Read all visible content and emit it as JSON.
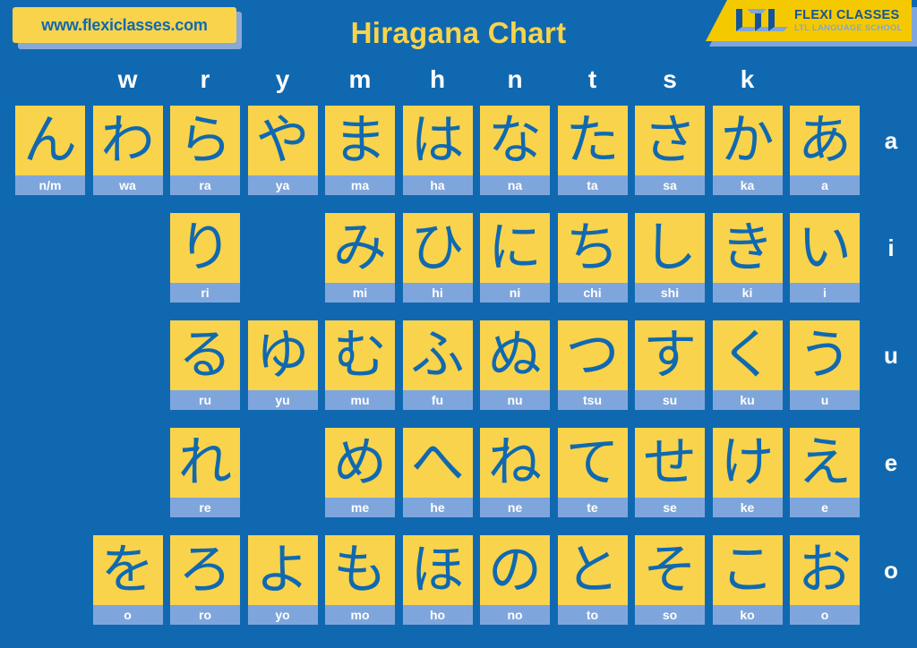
{
  "header": {
    "url_badge": "www.flexiclasses.com",
    "title": "Hiragana Chart",
    "logo": {
      "mark": "ltl-logo-icon",
      "title": "FLEXI CLASSES",
      "subtitle": "LTL LANGUAGE SCHOOL"
    }
  },
  "colors": {
    "background_blue": "#1069b0",
    "cell_yellow": "#f9d34b",
    "romaji_strip_blue": "#7fa6dc",
    "logo_yellow": "#f5c900",
    "kana_blue": "#1069b0",
    "title_yellow": "#f9d34b",
    "white": "#ffffff"
  },
  "chart_data": {
    "type": "table",
    "title": "Hiragana Chart",
    "column_headers": [
      "",
      "w",
      "r",
      "y",
      "m",
      "h",
      "n",
      "t",
      "s",
      "k"
    ],
    "row_labels": [
      "a",
      "i",
      "u",
      "e",
      "o"
    ],
    "rows": [
      {
        "vowel": "a",
        "cells": [
          {
            "kana": "ん",
            "romaji": "n/m"
          },
          {
            "kana": "わ",
            "romaji": "wa"
          },
          {
            "kana": "ら",
            "romaji": "ra"
          },
          {
            "kana": "や",
            "romaji": "ya"
          },
          {
            "kana": "ま",
            "romaji": "ma"
          },
          {
            "kana": "は",
            "romaji": "ha"
          },
          {
            "kana": "な",
            "romaji": "na"
          },
          {
            "kana": "た",
            "romaji": "ta"
          },
          {
            "kana": "さ",
            "romaji": "sa"
          },
          {
            "kana": "か",
            "romaji": "ka"
          },
          {
            "kana": "あ",
            "romaji": "a"
          }
        ]
      },
      {
        "vowel": "i",
        "cells": [
          null,
          null,
          {
            "kana": "り",
            "romaji": "ri"
          },
          null,
          {
            "kana": "み",
            "romaji": "mi"
          },
          {
            "kana": "ひ",
            "romaji": "hi"
          },
          {
            "kana": "に",
            "romaji": "ni"
          },
          {
            "kana": "ち",
            "romaji": "chi"
          },
          {
            "kana": "し",
            "romaji": "shi"
          },
          {
            "kana": "き",
            "romaji": "ki"
          },
          {
            "kana": "い",
            "romaji": "i"
          }
        ]
      },
      {
        "vowel": "u",
        "cells": [
          null,
          null,
          {
            "kana": "る",
            "romaji": "ru"
          },
          {
            "kana": "ゆ",
            "romaji": "yu"
          },
          {
            "kana": "む",
            "romaji": "mu"
          },
          {
            "kana": "ふ",
            "romaji": "fu"
          },
          {
            "kana": "ぬ",
            "romaji": "nu"
          },
          {
            "kana": "つ",
            "romaji": "tsu"
          },
          {
            "kana": "す",
            "romaji": "su"
          },
          {
            "kana": "く",
            "romaji": "ku"
          },
          {
            "kana": "う",
            "romaji": "u"
          }
        ]
      },
      {
        "vowel": "e",
        "cells": [
          null,
          null,
          {
            "kana": "れ",
            "romaji": "re"
          },
          null,
          {
            "kana": "め",
            "romaji": "me"
          },
          {
            "kana": "へ",
            "romaji": "he"
          },
          {
            "kana": "ね",
            "romaji": "ne"
          },
          {
            "kana": "て",
            "romaji": "te"
          },
          {
            "kana": "せ",
            "romaji": "se"
          },
          {
            "kana": "け",
            "romaji": "ke"
          },
          {
            "kana": "え",
            "romaji": "e"
          }
        ]
      },
      {
        "vowel": "o",
        "cells": [
          null,
          {
            "kana": "を",
            "romaji": "o"
          },
          {
            "kana": "ろ",
            "romaji": "ro"
          },
          {
            "kana": "よ",
            "romaji": "yo"
          },
          {
            "kana": "も",
            "romaji": "mo"
          },
          {
            "kana": "ほ",
            "romaji": "ho"
          },
          {
            "kana": "の",
            "romaji": "no"
          },
          {
            "kana": "と",
            "romaji": "to"
          },
          {
            "kana": "そ",
            "romaji": "so"
          },
          {
            "kana": "こ",
            "romaji": "ko"
          },
          {
            "kana": "お",
            "romaji": "o"
          }
        ]
      }
    ]
  }
}
